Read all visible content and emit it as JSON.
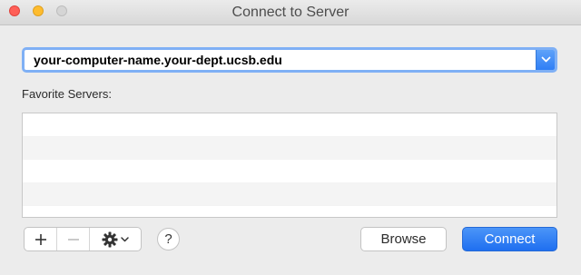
{
  "window": {
    "title": "Connect to Server"
  },
  "server_address": {
    "value": "your-computer-name.your-dept.ucsb.edu"
  },
  "favorites": {
    "label": "Favorite Servers:",
    "items": []
  },
  "toolbar": {
    "add_symbol": "+",
    "remove_symbol": "−",
    "help_symbol": "?"
  },
  "buttons": {
    "browse_label": "Browse",
    "connect_label": "Connect"
  },
  "colors": {
    "accent": "#2f7ef5",
    "focus_ring": "#7fb0f5",
    "window_bg": "#ececec"
  },
  "icons": {
    "dropdown": "chevron-down-icon",
    "action": "gear-icon"
  }
}
